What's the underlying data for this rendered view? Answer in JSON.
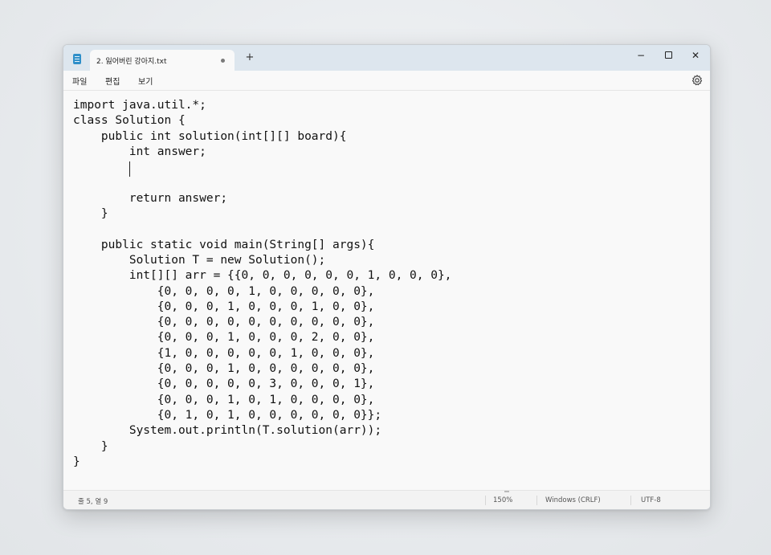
{
  "window": {
    "tab_title": "2. 잃어버린 강아지.txt",
    "new_tab_label": "+",
    "controls": {
      "minimize": "−",
      "close": "✕"
    }
  },
  "menu": {
    "file": "파일",
    "edit": "편집",
    "view": "보기",
    "settings_icon": "gear-icon"
  },
  "editor": {
    "text": "import java.util.*;\nclass Solution {\n    public int solution(int[][] board){\n        int answer;\n        \n\n        return answer;\n    }\n\n    public static void main(String[] args){\n        Solution T = new Solution();\n        int[][] arr = {{0, 0, 0, 0, 0, 0, 1, 0, 0, 0},\n            {0, 0, 0, 0, 1, 0, 0, 0, 0, 0},\n            {0, 0, 0, 1, 0, 0, 0, 1, 0, 0},\n            {0, 0, 0, 0, 0, 0, 0, 0, 0, 0},\n            {0, 0, 0, 1, 0, 0, 0, 2, 0, 0},\n            {1, 0, 0, 0, 0, 0, 1, 0, 0, 0},\n            {0, 0, 0, 1, 0, 0, 0, 0, 0, 0},\n            {0, 0, 0, 0, 0, 3, 0, 0, 0, 1},\n            {0, 0, 0, 1, 0, 1, 0, 0, 0, 0},\n            {0, 1, 0, 1, 0, 0, 0, 0, 0, 0}};\n        System.out.println(T.solution(arr));\n    }\n}"
  },
  "status": {
    "position": "줄 5, 열 9",
    "zoom": "150%",
    "line_ending": "Windows (CRLF)",
    "encoding": "UTF-8"
  },
  "colors": {
    "titlebar": "#dde6ee",
    "editor_bg": "#f9f9f9",
    "app_icon": "#2f8fc9"
  }
}
